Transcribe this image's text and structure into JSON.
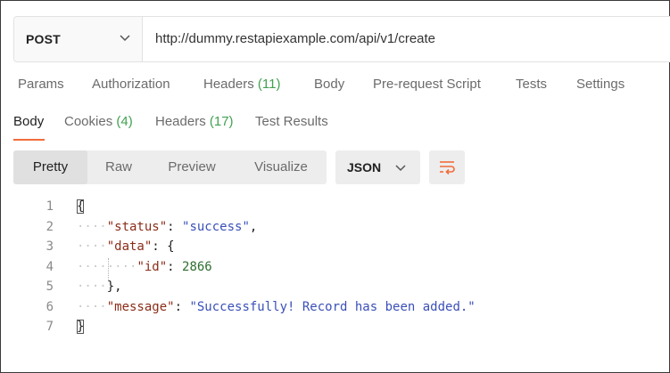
{
  "request": {
    "method": "POST",
    "url": "http://dummy.restapiexample.com/api/v1/create"
  },
  "request_tabs": [
    {
      "label": "Params",
      "count": ""
    },
    {
      "label": "Authorization",
      "count": ""
    },
    {
      "label": "Headers",
      "count": "(11)"
    },
    {
      "label": "Body",
      "count": ""
    },
    {
      "label": "Pre-request Script",
      "count": ""
    },
    {
      "label": "Tests",
      "count": ""
    },
    {
      "label": "Settings",
      "count": ""
    }
  ],
  "response_tabs": [
    {
      "label": "Body",
      "count": "",
      "active": true
    },
    {
      "label": "Cookies",
      "count": "(4)"
    },
    {
      "label": "Headers",
      "count": "(17)"
    },
    {
      "label": "Test Results",
      "count": ""
    }
  ],
  "view_modes": [
    "Pretty",
    "Raw",
    "Preview",
    "Visualize"
  ],
  "active_view": "Pretty",
  "format": "JSON",
  "code_lines": [
    {
      "number": "1",
      "text": "{"
    },
    {
      "number": "2",
      "key": "\"status\"",
      "value": "\"success\""
    },
    {
      "number": "3",
      "key": "\"data\"",
      "text": "{"
    },
    {
      "number": "4",
      "key": "\"id\"",
      "value": "2866"
    },
    {
      "number": "5",
      "text": "},"
    },
    {
      "number": "6",
      "key": "\"message\"",
      "value": "\"Successfully! Record has been added.\""
    },
    {
      "number": "7",
      "text": "}"
    }
  ],
  "colors": {
    "accent": "#f26b3a",
    "count": "#41a151",
    "json_key": "#8b2c18",
    "json_string": "#3a50b8",
    "json_number": "#2f6f2f"
  },
  "icons": {
    "method_dropdown": "chevron-down-icon",
    "format_dropdown": "chevron-down-icon",
    "wrap": "wrap-lines-icon"
  }
}
